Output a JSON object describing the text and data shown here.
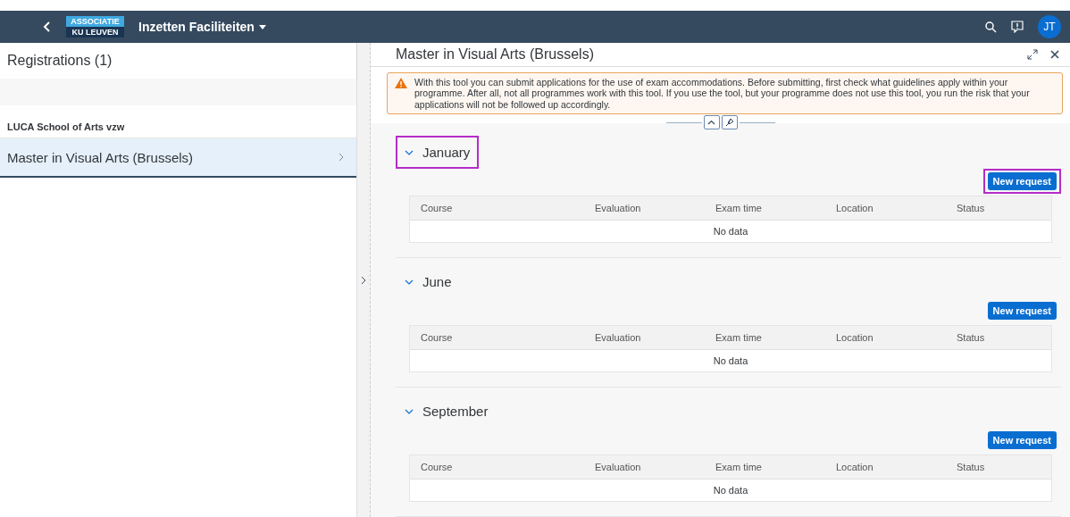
{
  "shell": {
    "logo_top": "ASSOCIATIE",
    "logo_bottom": "KU LEUVEN",
    "app_title": "Inzetten Faciliteiten",
    "avatar": "JT"
  },
  "master": {
    "title": "Registrations (1)",
    "group": "LUCA School of Arts vzw",
    "items": [
      {
        "label": "Master in Visual Arts (Brussels)",
        "selected": true
      }
    ]
  },
  "detail": {
    "title": "Master in Visual Arts (Brussels)",
    "warning": "With this tool you can submit applications for the use of exam accommodations. Before submitting, first check what guidelines apply within your programme. After all, not all programmes work with this tool. If you use the tool, but your programme does not use this tool, you run the risk that your applications will not be followed up accordingly.",
    "sections": [
      {
        "title": "January",
        "expanded": true,
        "header_highlighted": true,
        "button": "New request",
        "button_highlighted": true,
        "columns": [
          "Course",
          "Evaluation",
          "Exam time",
          "Location",
          "Status"
        ],
        "empty": "No data"
      },
      {
        "title": "June",
        "expanded": true,
        "header_highlighted": false,
        "button": "New request",
        "button_highlighted": false,
        "columns": [
          "Course",
          "Evaluation",
          "Exam time",
          "Location",
          "Status"
        ],
        "empty": "No data"
      },
      {
        "title": "September",
        "expanded": true,
        "header_highlighted": false,
        "button": "New request",
        "button_highlighted": false,
        "columns": [
          "Course",
          "Evaluation",
          "Exam time",
          "Location",
          "Status"
        ],
        "empty": "No data"
      }
    ]
  }
}
